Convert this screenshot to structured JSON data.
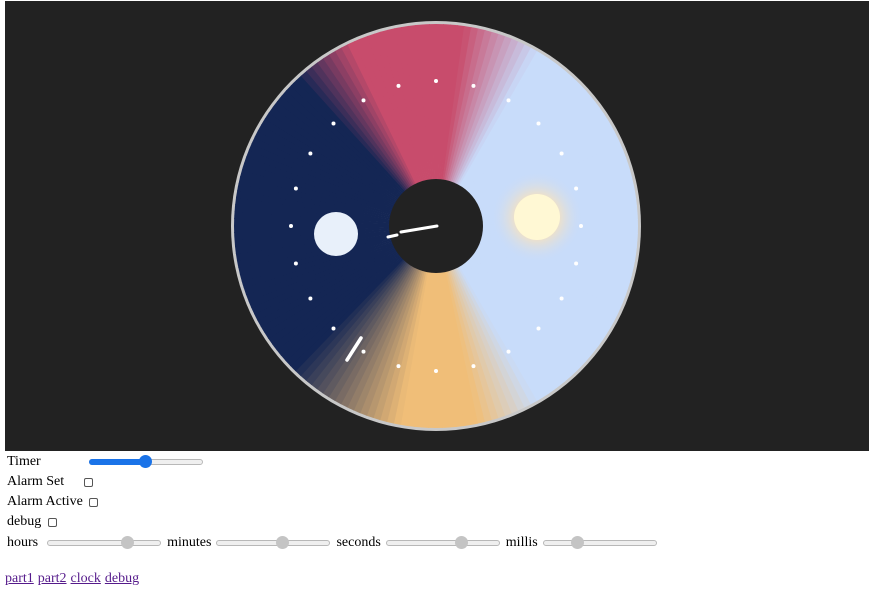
{
  "controls": {
    "timer_label": "Timer",
    "timer_value": 0.49,
    "alarm_set_label": "Alarm Set",
    "alarm_set_checked": false,
    "alarm_active_label": "Alarm Active",
    "alarm_active_checked": false,
    "debug_label": "debug",
    "debug_checked": false,
    "hours_label": "hours",
    "hours_value": 0.72,
    "minutes_label": "minutes",
    "minutes_value": 0.58,
    "seconds_label": "seconds",
    "seconds_value": 0.68,
    "millis_label": "millis",
    "millis_value": 0.28
  },
  "links": [
    {
      "label": "part1"
    },
    {
      "label": "part2"
    },
    {
      "label": "clock"
    },
    {
      "label": "debug"
    }
  ],
  "colors": {
    "canvas_bg": "#222222",
    "rim": "#c8c8c8",
    "night": "#142654",
    "dusk": "#c84c6c",
    "day": "#c8dcfa",
    "dawn": "#f0be78",
    "moon": "#e8f0fa",
    "sun": "#fff8d4",
    "accent": "#1a73e8"
  }
}
